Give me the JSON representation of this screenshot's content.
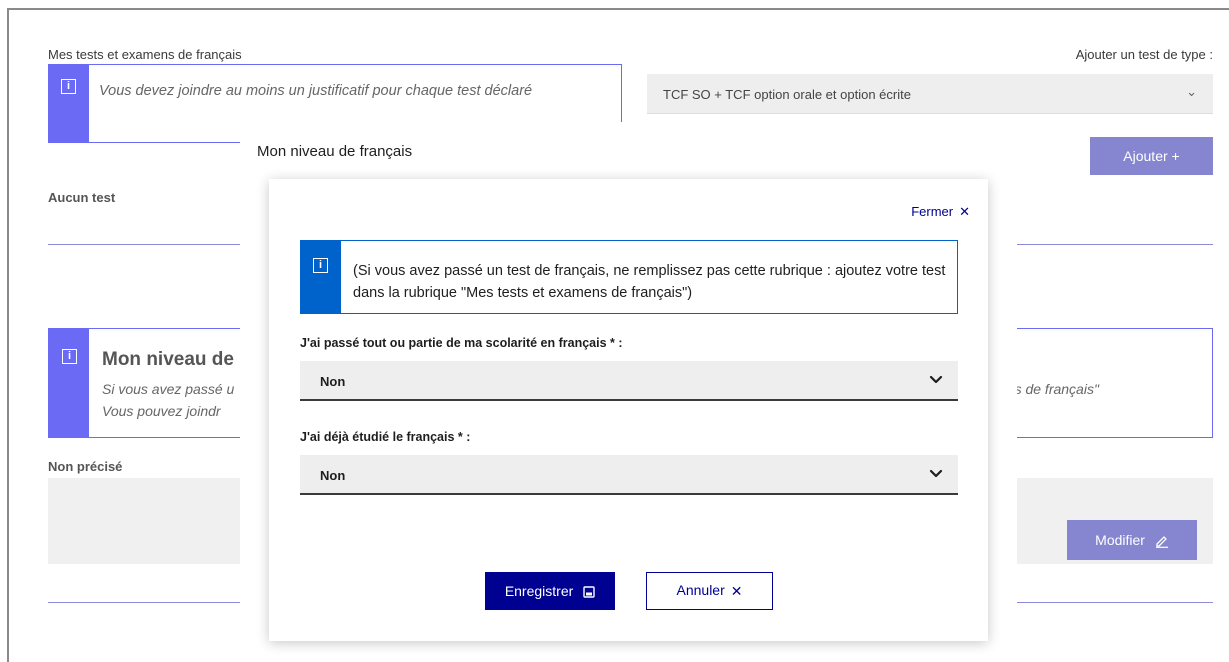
{
  "background": {
    "tests_label": "Mes tests et examens de français",
    "add_type_label": "Ajouter un test de type :",
    "tests_info": "Vous devez joindre au moins un justificatif pour chaque test déclaré",
    "test_type_select": "TCF SO + TCF option orale et option écrite",
    "add_button": "Ajouter +",
    "no_test": "Aucun test",
    "level_title": "Mon niveau de",
    "level_line1": "Si vous avez passé u",
    "level_line2": "Vous pouvez joindr",
    "level_line_right": "ens de français\"",
    "not_specified": "Non précisé",
    "modify_button": "Modifier"
  },
  "modal": {
    "title": "Mon niveau de français",
    "close_label": "Fermer",
    "info_text": "(Si vous avez passé un test de français, ne remplissez pas cette rubrique : ajoutez votre test dans la rubrique \"Mes tests et examens de français\")",
    "field1_label": "J'ai passé tout ou partie de ma scolarité en français * :",
    "field1_value": "Non",
    "field2_label": "J'ai déjà étudié le français * :",
    "field2_value": "Non",
    "save_button": "Enregistrer",
    "cancel_button": "Annuler"
  },
  "colors": {
    "primary": "#000091",
    "info_blue": "#0063cb",
    "lavender": "#8585d0"
  }
}
